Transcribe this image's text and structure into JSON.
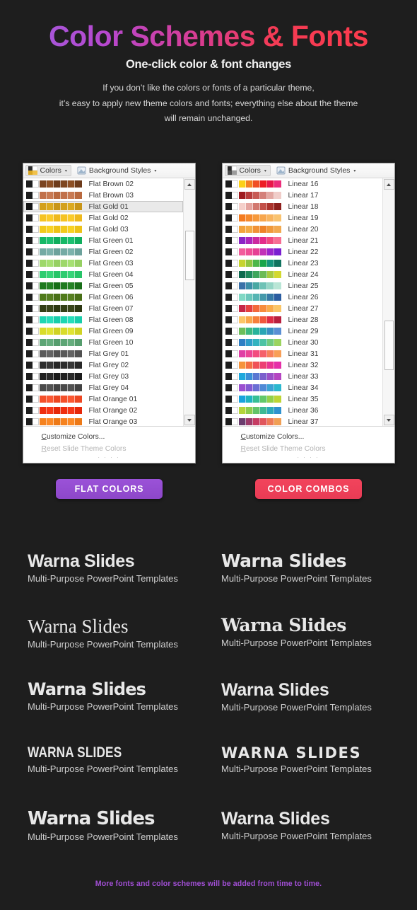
{
  "hero": {
    "title": "Color Schemes & Fonts",
    "subtitle": "One-click color & font changes",
    "para_line1": "If you don’t like the colors or fonts of a particular theme,",
    "para_line2": "it’s easy to apply new theme colors and fonts; everything else about the theme",
    "para_line3": "will remain unchanged.",
    "gradient_start": "#a855d8",
    "gradient_end": "#fb3b4d"
  },
  "panels": [
    {
      "name": "flat-colors-panel",
      "toolbar": {
        "colors_label": "Colors",
        "background_styles_label": "Background Styles",
        "caret": "▾"
      },
      "scroll": {
        "thumb_top_pct": 18,
        "thumb_height_pct": 22
      },
      "footer": {
        "customize": "Customize Colors...",
        "reset": "Reset Slide Theme Colors",
        "grip": "· · · ·"
      },
      "rows": [
        {
          "label": "Flat Brown 02",
          "selected": false,
          "dark": "#1d1d1d",
          "colors": [
            "#7b4420",
            "#8d4f24",
            "#6d3b1b",
            "#7e4620",
            "#8d4f24",
            "#6d3b1b"
          ]
        },
        {
          "label": "Flat Brown 03",
          "selected": false,
          "dark": "#1d1d1d",
          "colors": [
            "#c1714b",
            "#c87a53",
            "#b9693f",
            "#c1714b",
            "#c87a53",
            "#b9693f"
          ]
        },
        {
          "label": "Flat Gold 01",
          "selected": true,
          "dark": "#141414",
          "colors": [
            "#d3a01c",
            "#dba91f",
            "#c89517",
            "#d3a01c",
            "#dba91f",
            "#c89517"
          ]
        },
        {
          "label": "Flat Gold 02",
          "selected": false,
          "dark": "#1d1d1d",
          "colors": [
            "#f5c324",
            "#fbcb2a",
            "#eeb91d",
            "#f5c324",
            "#fbcb2a",
            "#eeb91d"
          ]
        },
        {
          "label": "Flat Gold 03",
          "selected": false,
          "dark": "#1d1d1d",
          "colors": [
            "#f2ca1d",
            "#f8d223",
            "#ecc217",
            "#f2ca1d",
            "#f8d223",
            "#ecc217"
          ]
        },
        {
          "label": "Flat Green 01",
          "selected": false,
          "dark": "#1d1d1d",
          "colors": [
            "#16b866",
            "#1cc070",
            "#10ae5e",
            "#16b866",
            "#1cc070",
            "#10ae5e"
          ]
        },
        {
          "label": "Flat Green 02",
          "selected": false,
          "dark": "#1d1d1d",
          "colors": [
            "#74aaa4",
            "#7cb2ac",
            "#6ca29c",
            "#74aaa4",
            "#7cb2ac",
            "#6ca29c"
          ]
        },
        {
          "label": "Flat Green 03",
          "selected": false,
          "dark": "#1d1d1d",
          "colors": [
            "#9ed86a",
            "#a6e072",
            "#96d062",
            "#9ed86a",
            "#a6e072",
            "#96d062"
          ]
        },
        {
          "label": "Flat Green 04",
          "selected": false,
          "dark": "#1d1d1d",
          "colors": [
            "#2fcc70",
            "#37d478",
            "#27c468",
            "#2fcc70",
            "#37d478",
            "#27c468"
          ]
        },
        {
          "label": "Flat Green 05",
          "selected": false,
          "dark": "#1d1d1d",
          "colors": [
            "#1d7a1d",
            "#238223",
            "#176e17",
            "#1d7a1d",
            "#238223",
            "#176e17"
          ]
        },
        {
          "label": "Flat Green 06",
          "selected": false,
          "dark": "#1d1d1d",
          "colors": [
            "#4f7a1a",
            "#567f20",
            "#486f16",
            "#4f7a1a",
            "#567f20",
            "#486f16"
          ]
        },
        {
          "label": "Flat Green 07",
          "selected": false,
          "dark": "#1d1d1d",
          "colors": [
            "#333f16",
            "#3a461b",
            "#2d3812",
            "#333f16",
            "#3a461b",
            "#2d3812"
          ]
        },
        {
          "label": "Flat Green 08",
          "selected": false,
          "dark": "#1d1d1d",
          "colors": [
            "#1fd6b2",
            "#27deba",
            "#18cdaa",
            "#1fd6b2",
            "#27deba",
            "#18cdaa"
          ]
        },
        {
          "label": "Flat Green 09",
          "selected": false,
          "dark": "#1d1d1d",
          "colors": [
            "#d9dc2b",
            "#e1e433",
            "#d0d324",
            "#d9dc2b",
            "#e1e433",
            "#d0d324"
          ]
        },
        {
          "label": "Flat Green 10",
          "selected": false,
          "dark": "#1d1d1d",
          "colors": [
            "#5da575",
            "#65ad7d",
            "#559d6d",
            "#5da575",
            "#65ad7d",
            "#559d6d"
          ]
        },
        {
          "label": "Flat Grey 01",
          "selected": false,
          "dark": "#1d1d1d",
          "colors": [
            "#5a5a5a",
            "#636363",
            "#515151",
            "#5a5a5a",
            "#636363",
            "#515151"
          ]
        },
        {
          "label": "Flat Grey 02",
          "selected": false,
          "dark": "#1d1d1d",
          "colors": [
            "#2e2e2e",
            "#363636",
            "#272727",
            "#2e2e2e",
            "#363636",
            "#272727"
          ]
        },
        {
          "label": "Flat Grey 03",
          "selected": false,
          "dark": "#1d1d1d",
          "colors": [
            "#222222",
            "#2a2a2a",
            "#1b1b1b",
            "#222222",
            "#2a2a2a",
            "#1b1b1b"
          ]
        },
        {
          "label": "Flat Grey 04",
          "selected": false,
          "dark": "#1d1d1d",
          "colors": [
            "#4a4a4a",
            "#525252",
            "#424242",
            "#4a4a4a",
            "#525252",
            "#424242"
          ]
        },
        {
          "label": "Flat Orange 01",
          "selected": false,
          "dark": "#1d1d1d",
          "colors": [
            "#f4502a",
            "#fb5832",
            "#ec4722",
            "#f4502a",
            "#fb5832",
            "#ec4722"
          ]
        },
        {
          "label": "Flat Orange 02",
          "selected": false,
          "dark": "#1d1d1d",
          "colors": [
            "#ef2f10",
            "#f73718",
            "#e6280a",
            "#ef2f10",
            "#f73718",
            "#e6280a"
          ]
        },
        {
          "label": "Flat Orange 03",
          "selected": false,
          "dark": "#1d1d1d",
          "colors": [
            "#f5821f",
            "#fc8a27",
            "#ed7917",
            "#f5821f",
            "#fc8a27",
            "#ed7917"
          ]
        }
      ]
    },
    {
      "name": "color-combos-panel",
      "toolbar": {
        "colors_label": "Colors",
        "background_styles_label": "Background Styles",
        "caret": "▾"
      },
      "scroll": {
        "thumb_top_pct": 58,
        "thumb_height_pct": 22
      },
      "footer": {
        "customize": "Customize Colors...",
        "reset": "Reset Slide Theme Colors",
        "grip": "· · · ·"
      },
      "rows": [
        {
          "label": "Linear 16",
          "selected": false,
          "dark": "#1d1d1d",
          "colors": [
            "#fcd116",
            "#f58220",
            "#f04e23",
            "#ed1c24",
            "#e8174a",
            "#ec2d7b"
          ]
        },
        {
          "label": "Linear 17",
          "selected": false,
          "dark": "#1d1d1d",
          "colors": [
            "#9e1b20",
            "#b83c3c",
            "#c75a55",
            "#d4807a",
            "#e3a8a3",
            "#f0cdc9"
          ]
        },
        {
          "label": "Linear 18",
          "selected": false,
          "dark": "#1d1d1d",
          "colors": [
            "#f5cfca",
            "#e5a49f",
            "#d2786f",
            "#c25048",
            "#ab332c",
            "#8d1f1c"
          ]
        },
        {
          "label": "Linear 19",
          "selected": false,
          "dark": "#1d1d1d",
          "colors": [
            "#f47b20",
            "#f5892c",
            "#f6993c",
            "#f7a64d",
            "#f8b45e",
            "#f9c370"
          ]
        },
        {
          "label": "Linear 20",
          "selected": false,
          "dark": "#1d1d1d",
          "colors": [
            "#f2a33c",
            "#f3ab46",
            "#f09237",
            "#ee8328",
            "#f0993a",
            "#f2a94f"
          ]
        },
        {
          "label": "Linear 21",
          "selected": false,
          "dark": "#1d1d1d",
          "colors": [
            "#8b24c6",
            "#ad26bb",
            "#cc2a9f",
            "#e32d8a",
            "#f0497f",
            "#f76d93"
          ]
        },
        {
          "label": "Linear 22",
          "selected": false,
          "dark": "#1d1d1d",
          "colors": [
            "#f25d9c",
            "#ef4f96",
            "#e64194",
            "#c232b8",
            "#9b25cc",
            "#7a1fd0"
          ]
        },
        {
          "label": "Linear 23",
          "selected": false,
          "dark": "#1d1d1d",
          "colors": [
            "#c6d42e",
            "#8fc63f",
            "#4cb748",
            "#1aa64b",
            "#15957c",
            "#10735f"
          ]
        },
        {
          "label": "Linear 24",
          "selected": false,
          "dark": "#1d1d1d",
          "colors": [
            "#0f6b4f",
            "#1f8a5c",
            "#3fa65d",
            "#6cbb56",
            "#a7cb40",
            "#d3d930"
          ]
        },
        {
          "label": "Linear 25",
          "selected": false,
          "dark": "#1d1d1d",
          "colors": [
            "#3b71a8",
            "#3d8fa8",
            "#49a8a3",
            "#6ec2b6",
            "#95d6c6",
            "#b9e6d6"
          ]
        },
        {
          "label": "Linear 26",
          "selected": false,
          "dark": "#1d1d1d",
          "colors": [
            "#7fd8c4",
            "#6ac7bb",
            "#55b5b3",
            "#4499ab",
            "#3579a6",
            "#2a5ca0"
          ]
        },
        {
          "label": "Linear 27",
          "selected": false,
          "dark": "#1d1d1d",
          "colors": [
            "#c62747",
            "#e6413f",
            "#f2693c",
            "#f78c3c",
            "#f9ab4a",
            "#fbc667"
          ]
        },
        {
          "label": "Linear 28",
          "selected": false,
          "dark": "#1d1d1d",
          "colors": [
            "#fbc667",
            "#f9a74c",
            "#f5803c",
            "#f0573d",
            "#dd2c45",
            "#b81f3e"
          ]
        },
        {
          "label": "Linear 29",
          "selected": false,
          "dark": "#1d1d1d",
          "colors": [
            "#6cbe5a",
            "#3db97f",
            "#28b39c",
            "#2aa5b5",
            "#3a8ec4",
            "#5a8fd4"
          ]
        },
        {
          "label": "Linear 30",
          "selected": false,
          "dark": "#1d1d1d",
          "colors": [
            "#2f7fc4",
            "#2f9dc9",
            "#33b3bf",
            "#4dc3a4",
            "#72cb7f",
            "#9bd45f"
          ]
        },
        {
          "label": "Linear 31",
          "selected": false,
          "dark": "#1d1d1d",
          "colors": [
            "#e03fa6",
            "#ec4496",
            "#f24c7f",
            "#f5606a",
            "#f7805a",
            "#f89f56"
          ]
        },
        {
          "label": "Linear 32",
          "selected": false,
          "dark": "#1d1d1d",
          "colors": [
            "#f6943c",
            "#f47044",
            "#f05257",
            "#ec3f73",
            "#e93392",
            "#e62fa8"
          ]
        },
        {
          "label": "Linear 33",
          "selected": false,
          "dark": "#1d1d1d",
          "colors": [
            "#1ea8dd",
            "#3b8fd8",
            "#5a77d2",
            "#7b5fcc",
            "#9a4fc6",
            "#b545c2"
          ]
        },
        {
          "label": "Linear 34",
          "selected": false,
          "dark": "#1d1d1d",
          "colors": [
            "#9b4fd0",
            "#8359d2",
            "#6a6ed4",
            "#4f8ad6",
            "#3aa3d4",
            "#2bb8cf"
          ]
        },
        {
          "label": "Linear 35",
          "selected": false,
          "dark": "#1d1d1d",
          "colors": [
            "#19a3dd",
            "#1fb4c0",
            "#37bf95",
            "#62c86a",
            "#93d04a",
            "#bdd536"
          ]
        },
        {
          "label": "Linear 36",
          "selected": false,
          "dark": "#1d1d1d",
          "colors": [
            "#b4d43b",
            "#8ecd4d",
            "#64c46a",
            "#3eb994",
            "#2ca9bb",
            "#2f92cf"
          ]
        },
        {
          "label": "Linear 37",
          "selected": false,
          "dark": "#1d1d1d",
          "colors": [
            "#6b3d6e",
            "#9c3a6a",
            "#c63c63",
            "#e0565c",
            "#ed7a56",
            "#f09f54"
          ]
        }
      ]
    }
  ],
  "pills": [
    {
      "name": "flat-colors-button",
      "label": "FLAT COLORS",
      "color": "#9b52d8"
    },
    {
      "name": "color-combos-button",
      "label": "COLOR COMBOS",
      "color": "#f2445c"
    }
  ],
  "font_samples": [
    {
      "title": "Warna Slides",
      "subtitle": "Multi-Purpose PowerPoint Templates"
    },
    {
      "title": "Warna Slides",
      "subtitle": "Multi-Purpose PowerPoint Templates"
    },
    {
      "title": "Warna Slides",
      "subtitle": "Multi-Purpose PowerPoint Templates"
    },
    {
      "title": "Warna Slides",
      "subtitle": "Multi-Purpose PowerPoint Templates"
    },
    {
      "title": "Warna Slides",
      "subtitle": "Multi-Purpose PowerPoint Templates"
    },
    {
      "title": "Warna Slides",
      "subtitle": "Multi-Purpose PowerPoint Templates"
    },
    {
      "title": "WARNA SLIDES",
      "subtitle": "Multi-Purpose PowerPoint Templates"
    },
    {
      "title": "WARNA SLIDES",
      "subtitle": "Multi-Purpose PowerPoint Templates"
    },
    {
      "title": "Warna Slides",
      "subtitle": "Multi-Purpose PowerPoint Templates"
    },
    {
      "title": "Warna Slides",
      "subtitle": "Multi-Purpose PowerPoint Templates"
    }
  ],
  "footnote": "More fonts and color schemes will be added from time to time."
}
